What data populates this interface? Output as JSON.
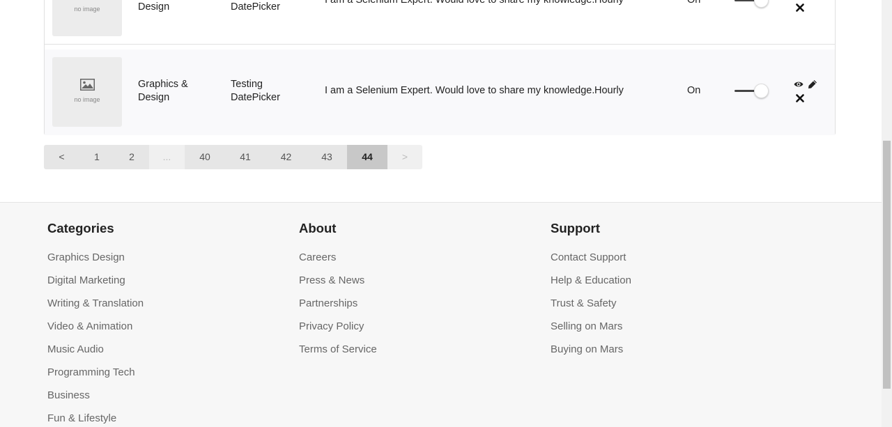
{
  "rows": [
    {
      "thumb_text": "no image",
      "category": "Graphics & Design",
      "title": "Testing DatePicker",
      "description": "I am a Selenium Expert. Would love to share my knowledge.",
      "type": "Hourly",
      "status": "On"
    },
    {
      "thumb_text": "no image",
      "category": "Graphics & Design",
      "title": "Testing DatePicker",
      "description": "I am a Selenium Expert. Would love to share my knowledge.",
      "type": "Hourly",
      "status": "On"
    }
  ],
  "pagination": {
    "prev": "<",
    "pages": [
      "1",
      "2",
      "...",
      "40",
      "41",
      "42",
      "43",
      "44"
    ],
    "current": "44",
    "next": ">"
  },
  "footer": {
    "categories": {
      "heading": "Categories",
      "links": [
        "Graphics Design",
        "Digital Marketing",
        "Writing & Translation",
        "Video & Animation",
        "Music Audio",
        "Programming Tech",
        "Business",
        "Fun & Lifestyle"
      ]
    },
    "about": {
      "heading": "About",
      "links": [
        "Careers",
        "Press & News",
        "Partnerships",
        "Privacy Policy",
        "Terms of Service"
      ]
    },
    "support": {
      "heading": "Support",
      "links": [
        "Contact Support",
        "Help & Education",
        "Trust & Safety",
        "Selling on Mars",
        "Buying on Mars"
      ]
    }
  },
  "icons": {
    "view": "eye-icon",
    "edit": "pencil-icon",
    "delete": "close-icon",
    "thumb": "image-placeholder-icon"
  }
}
